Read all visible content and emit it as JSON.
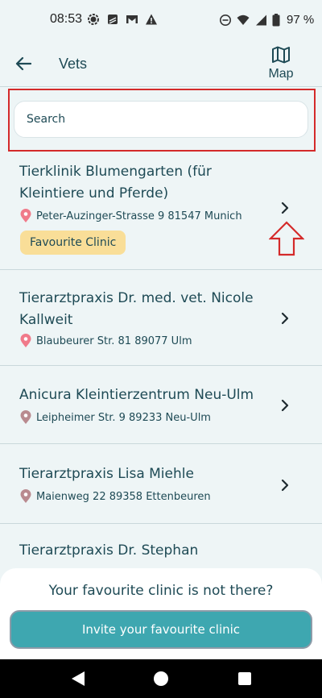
{
  "status_bar": {
    "time": "08:53",
    "battery": "97 %",
    "left_icons": [
      "signal-app-icon",
      "notes-app-icon",
      "gmail-icon",
      "alert-icon"
    ],
    "right_icons": [
      "do-not-disturb-icon",
      "wifi-icon",
      "cell-signal-icon",
      "battery-icon"
    ]
  },
  "header": {
    "title": "Vets",
    "map_label": "Map"
  },
  "search": {
    "placeholder": "Search"
  },
  "clinics": [
    {
      "name": "Tierklinik Blumengarten (für Kleintiere und Pferde)",
      "address": "Peter-Auzinger-Strasse 9 81547 Munich",
      "badge": "Favourite Clinic"
    },
    {
      "name": "Tierarztpraxis Dr. med. vet. Nicole Kallweit",
      "address": "Blaubeurer Str. 81 89077 Ulm"
    },
    {
      "name": "Anicura Kleintierzentrum Neu-Ulm",
      "address": "Leipheimer Str. 9 89233 Neu-Ulm"
    },
    {
      "name": "Tierarztpraxis Lisa Miehle",
      "address": "Maienweg 22 89358 Ettenbeuren"
    },
    {
      "name": "Tierarztpraxis Dr. Stephan",
      "address": ""
    }
  ],
  "bottom_sheet": {
    "prompt": "Your favourite clinic is not there?",
    "invite_label": "Invite your favourite clinic"
  },
  "colors": {
    "background": "#EEF5F6",
    "text": "#1E4A55",
    "accent": "#3EA7B0",
    "badge": "#F9DE98",
    "annotation": "#D42A2A"
  }
}
